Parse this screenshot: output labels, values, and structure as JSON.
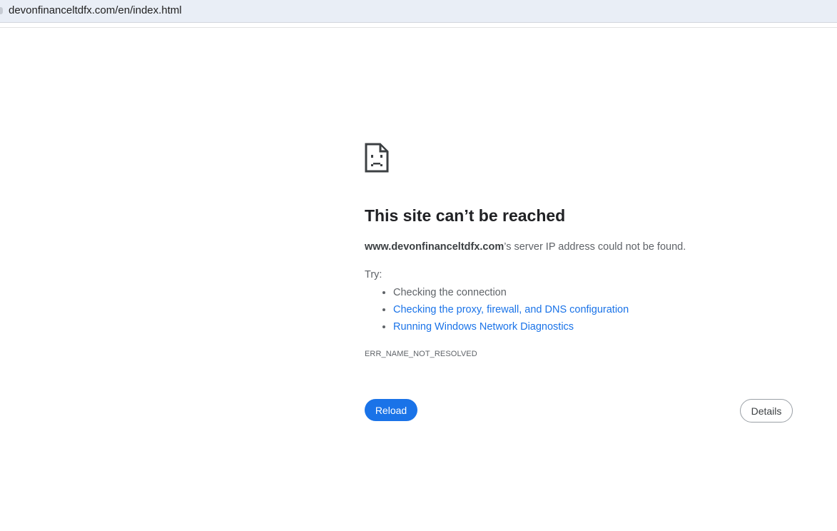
{
  "browser": {
    "url": "devonfinanceltdfx.com/en/index.html"
  },
  "error_page": {
    "icon": "sad-page-icon",
    "title": "This site can’t be reached",
    "summary_host": "www.devonfinanceltdfx.com",
    "summary_rest": "’s server IP address could not be found.",
    "try_label": "Try:",
    "suggestions": [
      {
        "label": "Checking the connection",
        "is_link": false
      },
      {
        "label": "Checking the proxy, firewall, and DNS configuration",
        "is_link": true
      },
      {
        "label": "Running Windows Network Diagnostics",
        "is_link": true
      }
    ],
    "error_code": "ERR_NAME_NOT_RESOLVED",
    "reload_label": "Reload",
    "details_label": "Details"
  },
  "colors": {
    "accent": "#1a73e8",
    "text": "#202124",
    "secondary_text": "#5f6368",
    "address_bar_bg": "#e9eef6"
  }
}
